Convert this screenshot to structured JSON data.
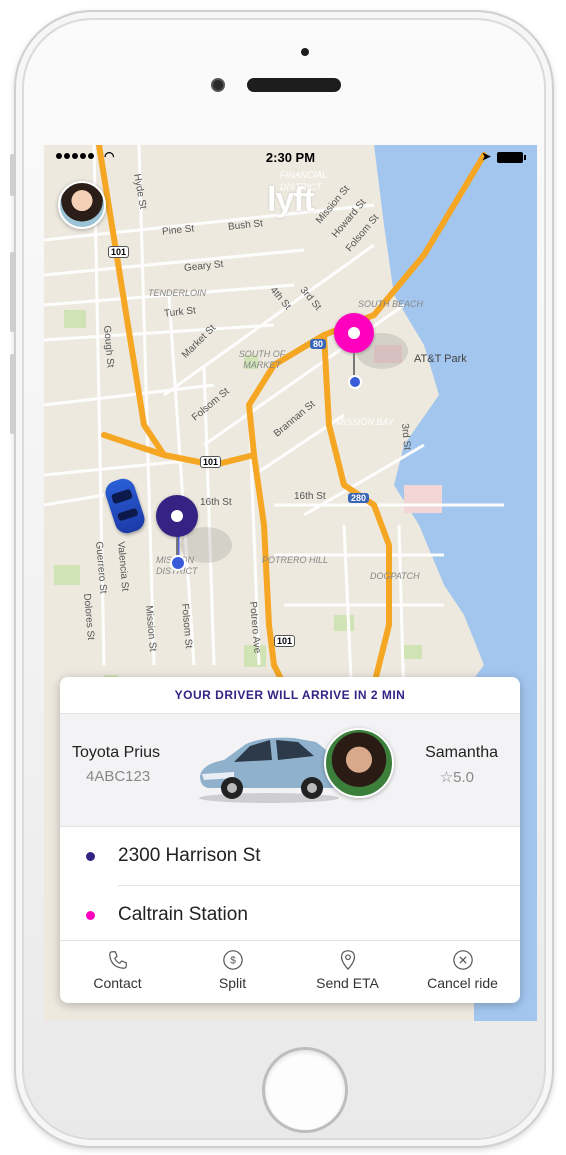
{
  "status_bar": {
    "time": "2:30 PM"
  },
  "app": {
    "logo_text": "lyft"
  },
  "map": {
    "labels": [
      {
        "text": "FINANCIAL DISTRICT"
      },
      {
        "text": "Hyde St"
      },
      {
        "text": "Pine St"
      },
      {
        "text": "Bush St"
      },
      {
        "text": "Mission St"
      },
      {
        "text": "Howard St"
      },
      {
        "text": "Folsom St"
      },
      {
        "text": "Geary St"
      },
      {
        "text": "TENDERLOIN"
      },
      {
        "text": "Turk St"
      },
      {
        "text": "Market St"
      },
      {
        "text": "4th St"
      },
      {
        "text": "3rd St"
      },
      {
        "text": "SOUTH BEACH"
      },
      {
        "text": "AT&T Park"
      },
      {
        "text": "SOUTH OF MARKET"
      },
      {
        "text": "Folsom St"
      },
      {
        "text": "Brannan St"
      },
      {
        "text": "MISSION BAY"
      },
      {
        "text": "16th St"
      },
      {
        "text": "16th St"
      },
      {
        "text": "MISSION DISTRICT"
      },
      {
        "text": "POTRERO HILL"
      },
      {
        "text": "DOGPATCH"
      },
      {
        "text": "Gough St"
      },
      {
        "text": "Guerrero St"
      },
      {
        "text": "Valencia St"
      },
      {
        "text": "Dolores St"
      },
      {
        "text": "Mission St"
      },
      {
        "text": "Folsom St"
      },
      {
        "text": "Potrero Ave"
      },
      {
        "text": "3rd St"
      }
    ],
    "shields": [
      "101",
      "80",
      "101",
      "280",
      "101"
    ]
  },
  "ride_card": {
    "banner": "YOUR DRIVER WILL ARRIVE IN 2 MIN",
    "car_model": "Toyota Prius",
    "plate": "4ABC123",
    "driver_name": "Samantha",
    "rating": "☆5.0",
    "pickup": "2300 Harrison St",
    "dropoff": "Caltrain Station",
    "actions": [
      {
        "label": "Contact",
        "icon": "phone-icon"
      },
      {
        "label": "Split",
        "icon": "dollar-icon"
      },
      {
        "label": "Send ETA",
        "icon": "location-pin-icon"
      },
      {
        "label": "Cancel ride",
        "icon": "cancel-icon"
      }
    ]
  },
  "colors": {
    "brand_pink": "#ff00bf",
    "brand_purple": "#352384",
    "route_orange": "#f5a623",
    "water": "#a3c6ef"
  }
}
